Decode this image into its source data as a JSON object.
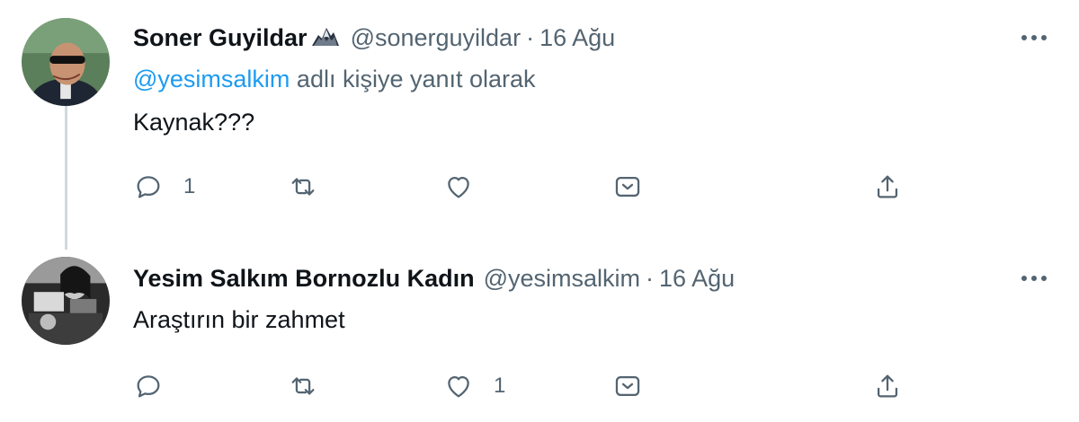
{
  "tweets": [
    {
      "name": "Soner Guyildar",
      "badge_icon": "eagle-icon",
      "handle": "@sonerguyildar",
      "separator": "·",
      "date": "16 Ağu",
      "replying_to_mention": "@yesimsalkim",
      "replying_to_suffix": " adlı kişiye yanıt olarak",
      "text": "Kaynak???",
      "reply_count": "1",
      "retweet_count": "",
      "like_count": ""
    },
    {
      "name": "Yesim Salkım Bornozlu Kadın",
      "handle": "@yesimsalkim",
      "separator": "·",
      "date": "16 Ağu",
      "text": "Araştırın bir zahmet",
      "reply_count": "",
      "retweet_count": "",
      "like_count": "1"
    }
  ],
  "colors": {
    "text": "#0f1419",
    "muted": "#536471",
    "accent": "#1d9bf0",
    "thread_line": "#cfd9de"
  }
}
